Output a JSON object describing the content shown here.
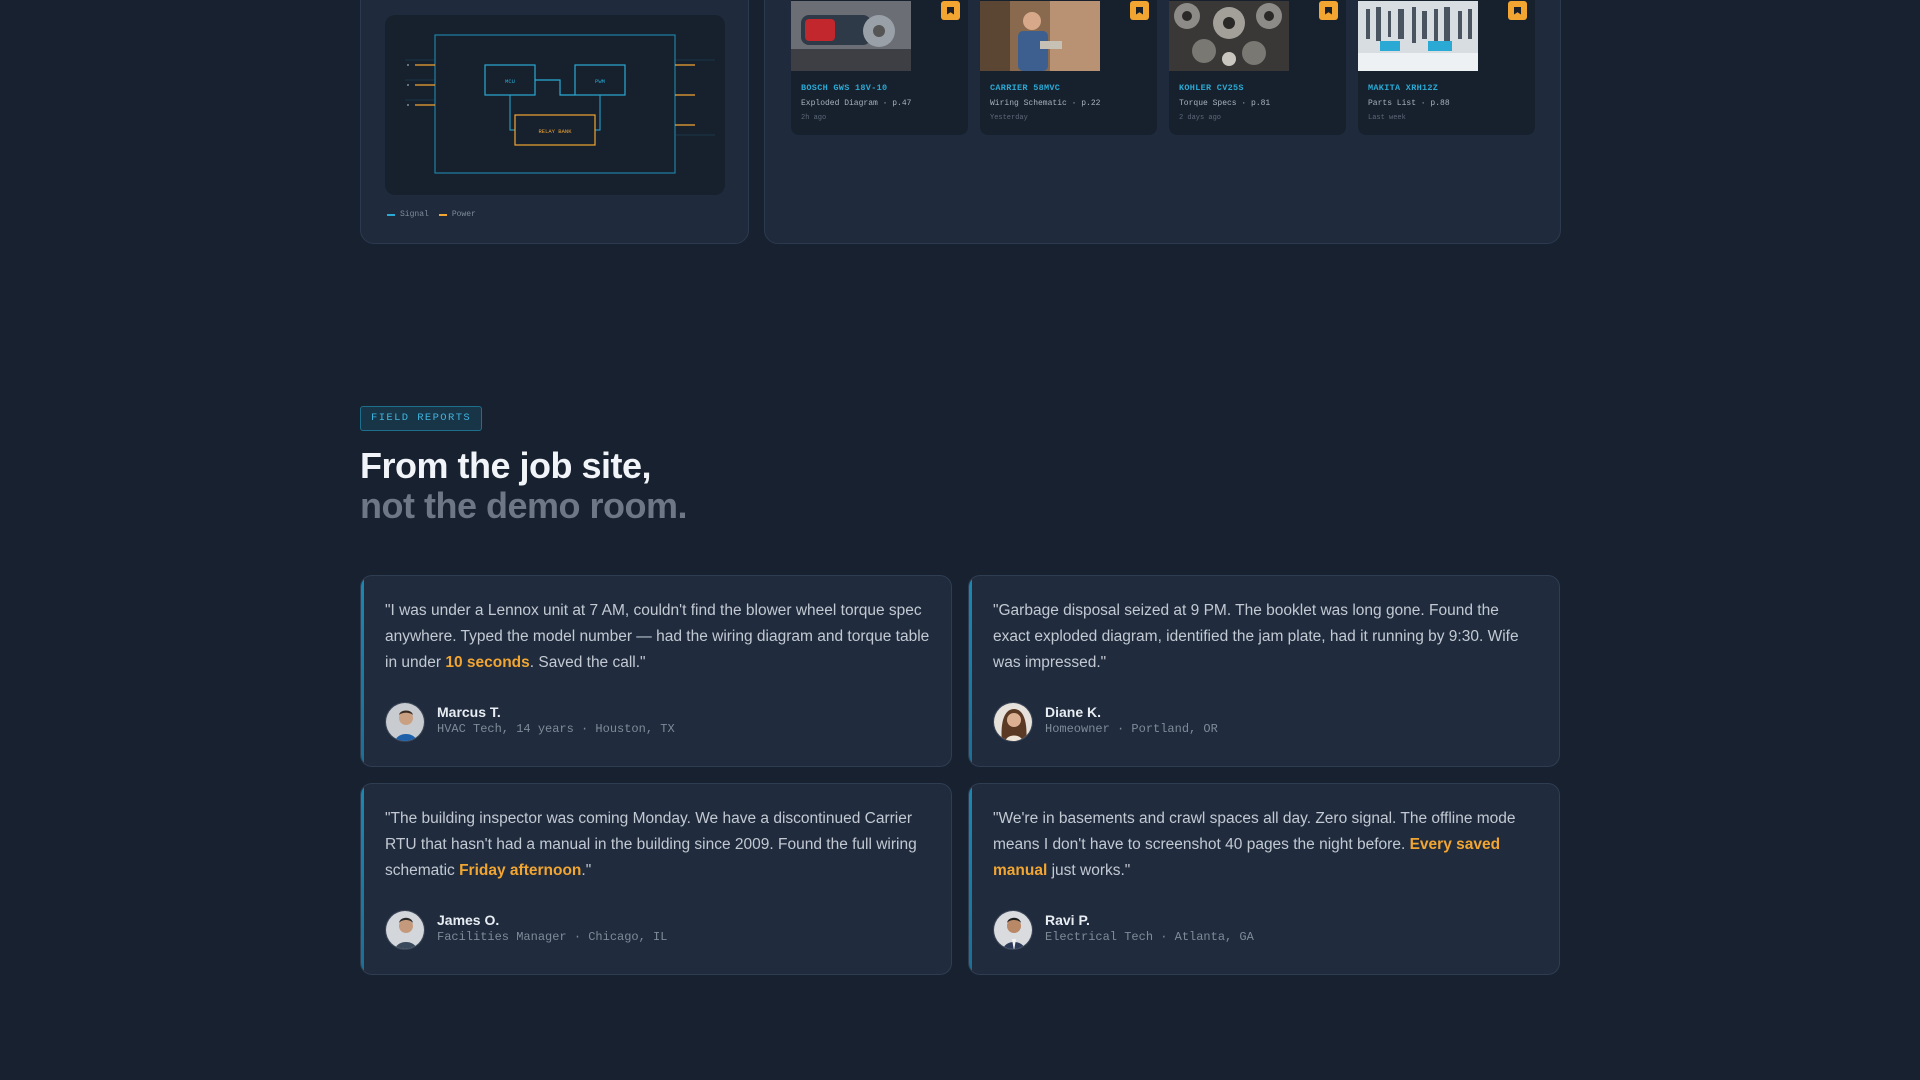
{
  "diagram": {
    "labels": [
      "MCU",
      "PWM",
      "RELAY BANK"
    ],
    "legend": [
      {
        "label": "Signal",
        "color": "#2aa9d4"
      },
      {
        "label": "Power",
        "color": "#f2a531"
      }
    ]
  },
  "manuals": [
    {
      "brand": "BOSCH GWS 18V-10",
      "meta": "Exploded Diagram · p.47",
      "time": "2h ago",
      "thumb": "angle-grinder-photo"
    },
    {
      "brand": "CARRIER 58MVC",
      "meta": "Wiring Schematic · p.22",
      "time": "Yesterday",
      "thumb": "technician-photo"
    },
    {
      "brand": "KOHLER CV25S",
      "meta": "Torque Specs · p.81",
      "time": "2 days ago",
      "thumb": "engine-gears-photo"
    },
    {
      "brand": "MAKITA XRH12Z",
      "meta": "Parts List · p.88",
      "time": "Last week",
      "thumb": "tool-wall-photo"
    }
  ],
  "section": {
    "tag": "FIELD REPORTS",
    "headline_line1": "From the job site,",
    "headline_line2": "not the demo room."
  },
  "testimonials": [
    {
      "quote_before": "\"I was under a Lennox unit at 7 AM, couldn't find the blower wheel torque spec anywhere. Typed the model number — had the wiring diagram and torque table in under ",
      "highlight": "10 seconds",
      "quote_after": ". Saved the call.\"",
      "name": "Marcus T.",
      "role": "HVAC Tech, 14 years · Houston, TX"
    },
    {
      "quote_before": "\"Garbage disposal seized at 9 PM. The booklet was long gone. Found the exact exploded diagram, identified the jam plate, had it running by 9:30. Wife was impressed.\"",
      "highlight": "",
      "quote_after": "",
      "name": "Diane K.",
      "role": "Homeowner · Portland, OR"
    },
    {
      "quote_before": "\"The building inspector was coming Monday. We have a discontinued Carrier RTU that hasn't had a manual in the building since 2009. Found the full wiring schematic ",
      "highlight": "Friday afternoon",
      "quote_after": ".\"",
      "name": "James O.",
      "role": "Facilities Manager · Chicago, IL"
    },
    {
      "quote_before": "\"We're in basements and crawl spaces all day. Zero signal. The offline mode means I don't have to screenshot 40 pages the night before. ",
      "highlight": "Every saved manual",
      "quote_after": " just works.\"",
      "name": "Ravi P.",
      "role": "Electrical Tech · Atlanta, GA"
    }
  ],
  "colors": {
    "background": "#18212f",
    "accent_blue": "#2aa9d4",
    "accent_orange": "#f2a531"
  }
}
